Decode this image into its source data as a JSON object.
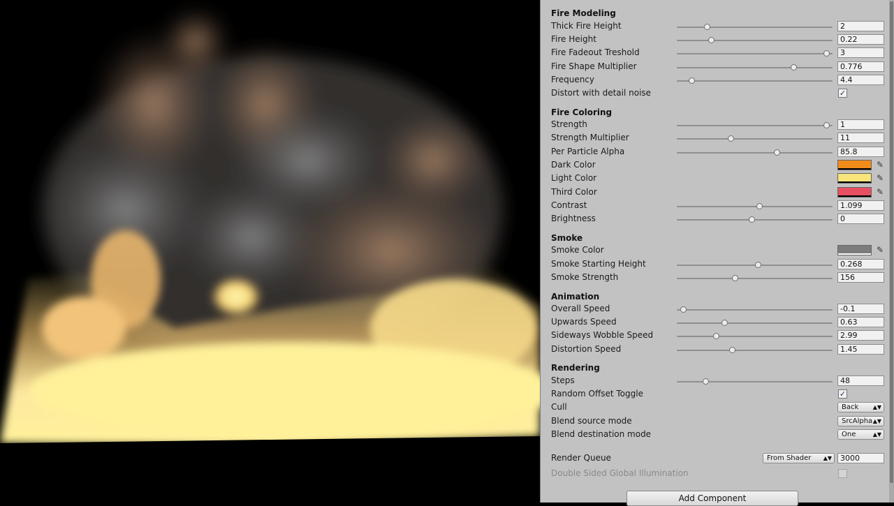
{
  "colors": {
    "dark": "#f08c1a",
    "light": "#f7e57c",
    "third": "#e65060",
    "smoke": "#7c7c7c",
    "inspector_bg": "#c2c2c2"
  },
  "viewport": {
    "name": "fire-render-preview"
  },
  "sections": {
    "fire_modeling": {
      "title": "Fire Modeling",
      "rows": [
        {
          "label": "Thick Fire Height",
          "value": "2",
          "fraction": 0.2
        },
        {
          "label": "Fire Height",
          "value": "0.22",
          "fraction": 0.23
        },
        {
          "label": "Fire Fadeout Treshold",
          "value": "3",
          "fraction": 1.0
        },
        {
          "label": "Fire Shape Multiplier",
          "value": "0.776",
          "fraction": 0.78
        },
        {
          "label": "Frequency",
          "value": "4.4",
          "fraction": 0.1
        }
      ],
      "distort_label": "Distort with detail noise",
      "distort_checked": "✓"
    },
    "fire_coloring": {
      "title": "Fire Coloring",
      "strength": {
        "label": "Strength",
        "value": "1",
        "fraction": 1.0
      },
      "strength_mult": {
        "label": "Strength Multiplier",
        "value": "11",
        "fraction": 0.36
      },
      "alpha": {
        "label": "Per Particle Alpha",
        "value": "85.8",
        "fraction": 0.67
      },
      "dark_color": "Dark Color",
      "light_color": "Light Color",
      "third_color": "Third Color",
      "contrast": {
        "label": "Contrast",
        "value": "1.099",
        "fraction": 0.55
      },
      "brightness": {
        "label": "Brightness",
        "value": "0",
        "fraction": 0.5
      }
    },
    "smoke": {
      "title": "Smoke",
      "color_label": "Smoke Color",
      "starting_height": {
        "label": "Smoke Starting Height",
        "value": "0.268",
        "fraction": 0.54
      },
      "strength": {
        "label": "Smoke Strength",
        "value": "156",
        "fraction": 0.39
      }
    },
    "animation": {
      "title": "Animation",
      "rows": [
        {
          "label": "Overall Speed",
          "value": "-0.1",
          "fraction": 0.04
        },
        {
          "label": "Upwards Speed",
          "value": "0.63",
          "fraction": 0.32
        },
        {
          "label": "Sideways Wobble Speed",
          "value": "2.99",
          "fraction": 0.26
        },
        {
          "label": "Distortion Speed",
          "value": "1.45",
          "fraction": 0.37
        }
      ]
    },
    "rendering": {
      "title": "Rendering",
      "steps": {
        "label": "Steps",
        "value": "48",
        "fraction": 0.19
      },
      "random_offset_label": "Random Offset Toggle",
      "random_offset_checked": "✓",
      "cull_label": "Cull",
      "cull_value": "Back",
      "blend_src_label": "Blend source mode",
      "blend_src_value": "SrcAlpha",
      "blend_dst_label": "Blend destination mode",
      "blend_dst_value": "One"
    }
  },
  "render_queue": {
    "label": "Render Queue",
    "mode": "From Shader",
    "value": "3000"
  },
  "double_sided": {
    "label": "Double Sided Global Illumination"
  },
  "add_component": "Add Component"
}
